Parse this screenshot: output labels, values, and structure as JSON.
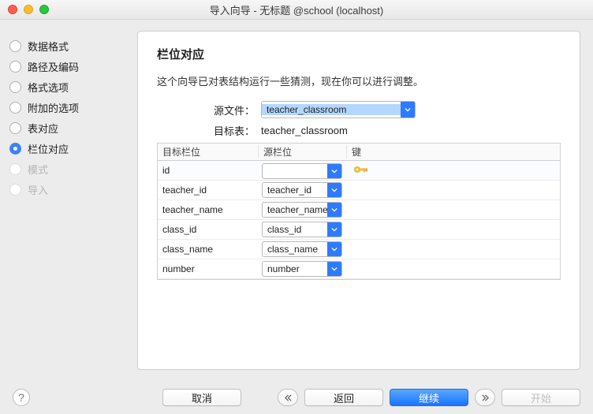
{
  "title": "导入向导 - 无标题 @school (localhost)",
  "sidebar": {
    "items": [
      {
        "label": "数据格式"
      },
      {
        "label": "路径及编码"
      },
      {
        "label": "格式选项"
      },
      {
        "label": "附加的选项"
      },
      {
        "label": "表对应"
      },
      {
        "label": "栏位对应"
      },
      {
        "label": "模式"
      },
      {
        "label": "导入"
      }
    ]
  },
  "panel": {
    "heading": "栏位对应",
    "desc": "这个向导已对表结构运行一些猜测，现在你可以进行调整。",
    "source_label": "源文件：",
    "source_value": "teacher_classroom",
    "target_label": "目标表：",
    "target_value": "teacher_classroom",
    "grid": {
      "head": {
        "c1": "目标栏位",
        "c2": "源栏位",
        "c3": "键"
      },
      "rows": [
        {
          "target": "id",
          "source": "",
          "key": true
        },
        {
          "target": "teacher_id",
          "source": "teacher_id",
          "key": false
        },
        {
          "target": "teacher_name",
          "source": "teacher_name",
          "key": false
        },
        {
          "target": "class_id",
          "source": "class_id",
          "key": false
        },
        {
          "target": "class_name",
          "source": "class_name",
          "key": false
        },
        {
          "target": "number",
          "source": "number",
          "key": false
        }
      ]
    }
  },
  "footer": {
    "help": "?",
    "cancel": "取消",
    "back": "返回",
    "continue": "继续",
    "start": "开始"
  }
}
